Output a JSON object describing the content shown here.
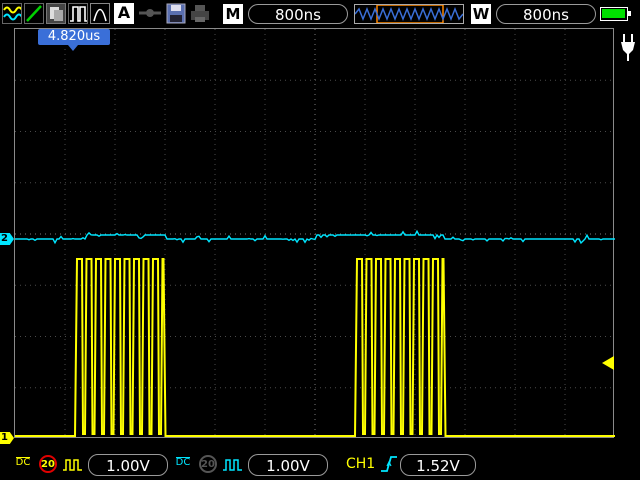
{
  "toolbar": {
    "icons": [
      "waveform-icon",
      "slope-icon",
      "persistence-icon",
      "pulse-icon",
      "auto-icon",
      "network-icon",
      "save-icon",
      "print-icon"
    ],
    "auto_label": "A"
  },
  "timebase": {
    "mode_label": "M",
    "value": "800ns"
  },
  "window": {
    "mode_label": "W",
    "value": "800ns"
  },
  "battery": {
    "level": 1.0,
    "color": "#00e000"
  },
  "cursor": {
    "time_label": "4.820us"
  },
  "channels": {
    "ch1": {
      "marker": "1",
      "color": "#ffff00",
      "coupling": "DC",
      "bandwidth_label": "20",
      "volts_div": "1.00V"
    },
    "ch2": {
      "marker": "2",
      "color": "#00e6ff",
      "coupling": "DC",
      "bandwidth_label": "20",
      "volts_div": "1.00V"
    }
  },
  "trigger": {
    "source": "CH1",
    "level": "1.52V"
  }
}
